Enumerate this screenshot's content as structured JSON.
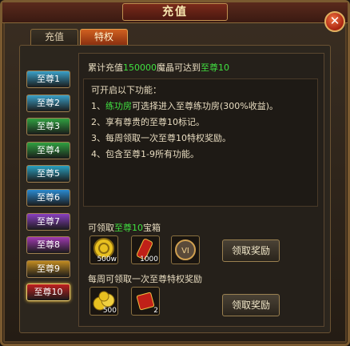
{
  "title": "充值",
  "tabs": [
    {
      "label": "充值"
    },
    {
      "label": "特权"
    }
  ],
  "vip_levels": [
    {
      "label": "至尊1",
      "color": "#3aa0c8"
    },
    {
      "label": "至尊2",
      "color": "#3aa0c8"
    },
    {
      "label": "至尊3",
      "color": "#30a040"
    },
    {
      "label": "至尊4",
      "color": "#30a040"
    },
    {
      "label": "至尊5",
      "color": "#2aa0c0"
    },
    {
      "label": "至尊6",
      "color": "#2a8ad0"
    },
    {
      "label": "至尊7",
      "color": "#8a40c0"
    },
    {
      "label": "至尊8",
      "color": "#a03ab0"
    },
    {
      "label": "至尊9",
      "color": "#c08a20"
    },
    {
      "label": "至尊10",
      "color": "#c02020"
    }
  ],
  "requirement": {
    "prefix": "累计充值",
    "amount": "150000",
    "middle": "魔晶可达到",
    "level": "至尊10"
  },
  "features_title": "可开启以下功能：",
  "features": [
    {
      "num": "1、",
      "highlight": "练功房",
      "text": "可选择进入至尊练功房(300%收益)。"
    },
    {
      "num": "2、",
      "highlight": "",
      "text": "享有尊贵的至尊10标记。"
    },
    {
      "num": "3、",
      "highlight": "",
      "text": "每周领取一次至尊10特权奖励。"
    },
    {
      "num": "4、",
      "highlight": "",
      "text": "包含至尊1-9所有功能。"
    }
  ],
  "chest_section": {
    "prefix": "可领取",
    "level": "至尊10",
    "suffix": "宝箱",
    "items": [
      {
        "icon": "gold-coin-icon",
        "count": "500w"
      },
      {
        "icon": "red-scroll-icon",
        "count": "1000"
      },
      {
        "icon": "vip-badge-icon",
        "count": "VI"
      }
    ],
    "button": "领取奖励"
  },
  "weekly_section": {
    "label": "每周可领取一次至尊特权奖励",
    "items": [
      {
        "icon": "gold-pile-icon",
        "count": "500"
      },
      {
        "icon": "red-package-icon",
        "count": "2"
      }
    ],
    "button": "领取奖励"
  }
}
